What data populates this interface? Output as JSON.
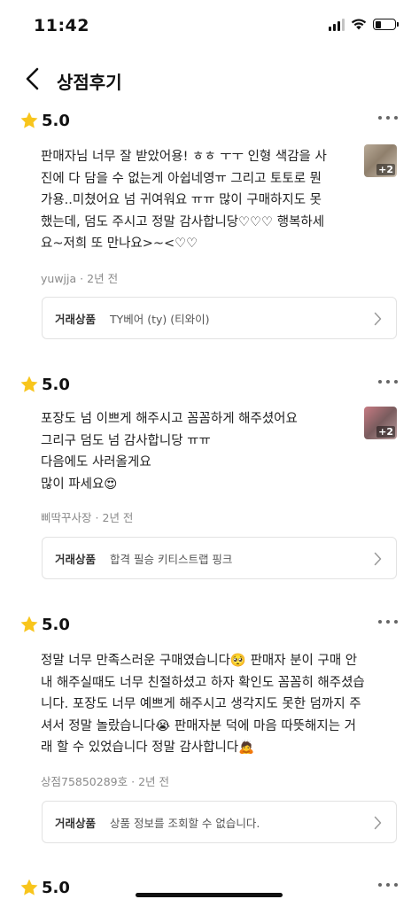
{
  "status_bar": {
    "time": "11:42",
    "battery_level": 0.3
  },
  "header": {
    "title": "상점후기",
    "back_icon": "chevron-left-icon"
  },
  "reviews": [
    {
      "rating": "5.0",
      "text": "판매자님 너무 잘 받았어용! ㅎㅎ ㅜㅜ 인형 색감을 사\n진에 다 담을 수 없는게 아쉽네영ㅠ 그리고 토토로 뭔\n가용..미쳤어요 넘 귀여워요 ㅠㅠ 많이 구매하지도 못\n했는데, 덤도 주시고 정말 감사합니당♡♡♡ 행복하세\n요~저희 또 만나요>~<♡♡",
      "photo_extra": "+2",
      "author": "yuwjja",
      "time_ago": "2년 전",
      "product_label": "거래상품",
      "product_name": "TY베어 (ty) (티와이)"
    },
    {
      "rating": "5.0",
      "text": "포장도 넘 이쁘게 해주시고 꼼꼼하게 해주셨어요\n그리구 덤도 넘 감사합니당 ㅠㅠ\n다음에도 사러올게요\n많이 파세요😍",
      "photo_extra": "+2",
      "author": "삐딱꾸사장",
      "time_ago": "2년 전",
      "product_label": "거래상품",
      "product_name": "합격 필승 키티스트랩 핑크"
    },
    {
      "rating": "5.0",
      "text": "정말 너무 만족스러운 구매였습니다🥺 판매자 분이 구매 안\n내 해주실때도 너무 친절하셨고 하자 확인도 꼼꼼히 해주셨습\n니다. 포장도 너무 예쁘게 해주시고 생각지도 못한 덤까지 주\n셔서 정말 놀랐습니다😭 판매자분 덕에 마음 따뜻해지는 거\n래 할 수 있었습니다 정말 감사합니다🙇",
      "author": "상점75850289호",
      "time_ago": "2년 전",
      "product_label": "거래상품",
      "product_name": "상품 정보를 조회할 수 없습니다."
    },
    {
      "rating": "5.0"
    }
  ],
  "colors": {
    "star": "#F8C51C",
    "meta_text": "#8A8A8A",
    "border": "#E2E2E2"
  }
}
